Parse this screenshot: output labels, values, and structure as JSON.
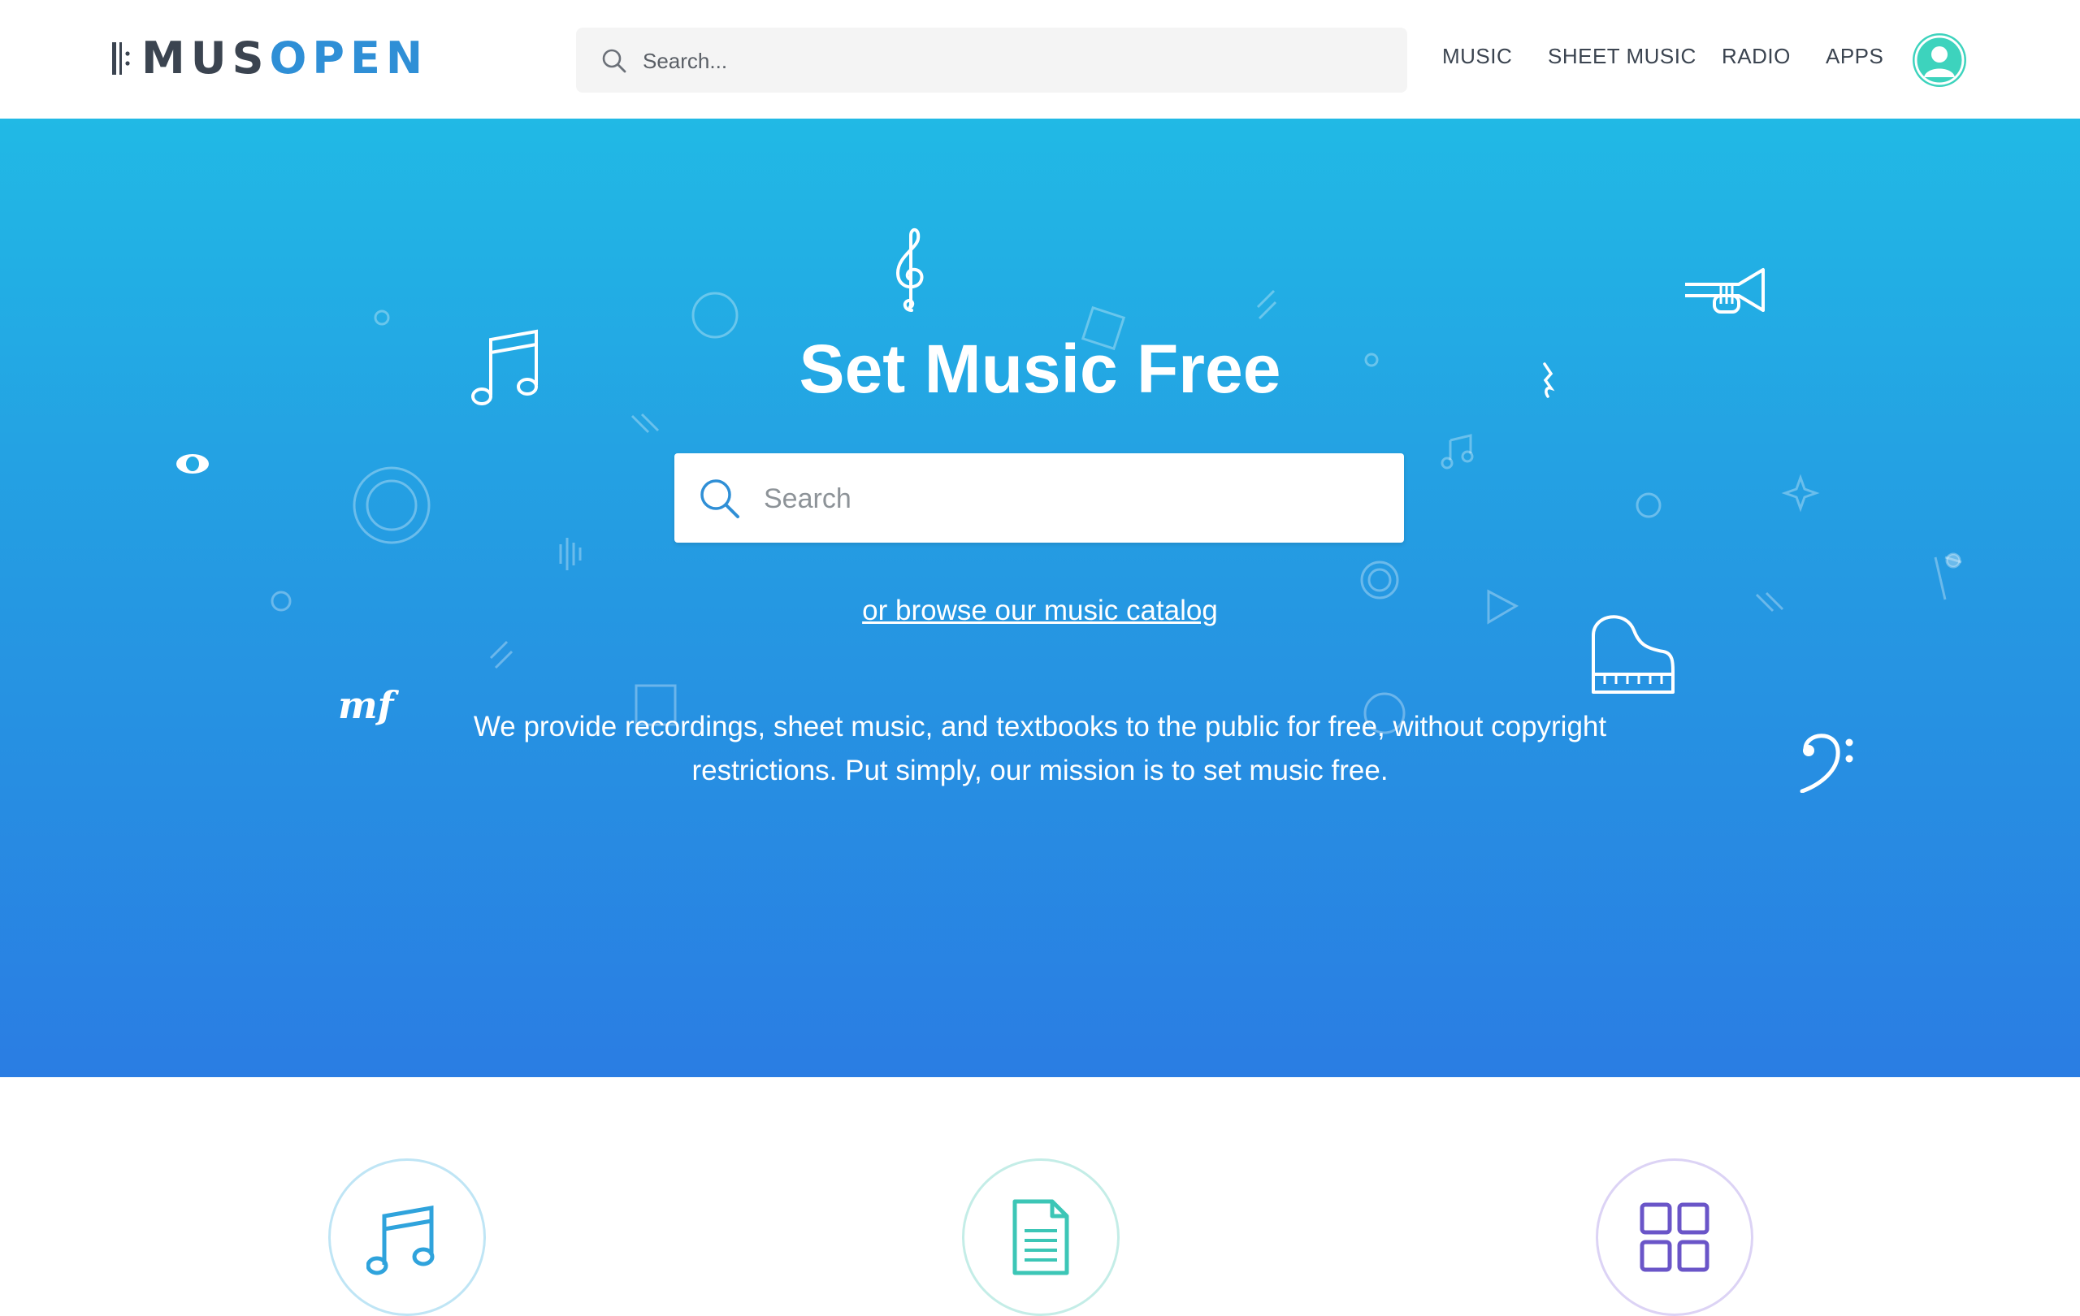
{
  "header": {
    "logo": {
      "mus": "MUS",
      "open": "OPEN"
    },
    "search": {
      "placeholder": "Search..."
    },
    "nav": [
      "MUSIC",
      "SHEET MUSIC",
      "RADIO",
      "APPS"
    ]
  },
  "hero": {
    "title": "Set Music Free",
    "search": {
      "placeholder": "Search"
    },
    "browse_link": "or browse our music catalog",
    "mission": "We provide recordings, sheet music, and textbooks to the public for free, without copyright restrictions. Put simply, our mission is to set music free."
  },
  "features": [
    {
      "icon": "music-note-icon",
      "color": "#2fa3dc"
    },
    {
      "icon": "document-icon",
      "color": "#3cc6b6"
    },
    {
      "icon": "apps-grid-icon",
      "color": "#6a55c8"
    }
  ],
  "colors": {
    "brand_dark": "#3b4450",
    "brand_blue": "#2f8fd6",
    "hero_top": "#21b9e5",
    "hero_bottom": "#2a7de3",
    "avatar": "#3dd3bd"
  }
}
